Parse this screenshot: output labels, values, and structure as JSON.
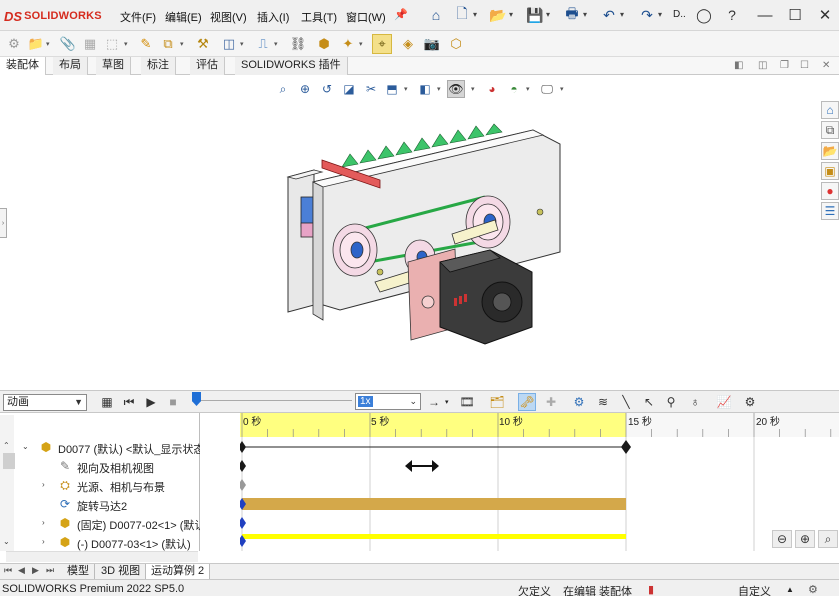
{
  "app": {
    "logo_mark": "DS",
    "logo_text": "SOLIDWORKS"
  },
  "menu": [
    {
      "id": "file",
      "label": "文件(F)"
    },
    {
      "id": "edit",
      "label": "编辑(E)"
    },
    {
      "id": "view",
      "label": "视图(V)"
    },
    {
      "id": "insert",
      "label": "插入(I)"
    },
    {
      "id": "tools",
      "label": "工具(T)"
    },
    {
      "id": "window",
      "label": "窗口(W)"
    }
  ],
  "quick_access": {
    "truncated_label": "D.."
  },
  "command_tabs": [
    {
      "label": "装配体",
      "active": true
    },
    {
      "label": "布局",
      "active": false
    },
    {
      "label": "草图",
      "active": false
    },
    {
      "label": "标注",
      "active": false
    },
    {
      "label": "评估",
      "active": false
    },
    {
      "label": "SOLIDWORKS 插件",
      "active": false
    }
  ],
  "motion": {
    "study_type": "动画",
    "speed": "1x",
    "ruler_labels": [
      "0 秒",
      "5 秒",
      "10 秒",
      "15 秒",
      "20 秒"
    ]
  },
  "tree": [
    {
      "label": "D0077 (默认) <默认_显示状态",
      "expander": "collapse",
      "icon": "assembly-icon"
    },
    {
      "label": "视向及相机视图",
      "expander": "",
      "icon": "camera-icon"
    },
    {
      "label": "光源、相机与布景",
      "expander": "expand",
      "icon": "lights-icon"
    },
    {
      "label": "旋转马达2",
      "expander": "",
      "icon": "rotary-motor-icon"
    },
    {
      "label": "(固定) D0077-02<1> (默认",
      "expander": "expand",
      "icon": "part-icon"
    },
    {
      "label": "(-) D0077-03<1> (默认)",
      "expander": "expand",
      "icon": "part-icon"
    }
  ],
  "bottom_tabs": [
    {
      "label": "模型",
      "active": false
    },
    {
      "label": "3D 视图",
      "active": false
    },
    {
      "label": "运动算例 2",
      "active": true
    }
  ],
  "status": {
    "product": "SOLIDWORKS Premium 2022 SP5.0",
    "definition": "欠定义",
    "editing": "在编辑 装配体",
    "custom": "自定义"
  },
  "colors": {
    "logo": "#d52b1e",
    "ruler_highlight": "#ffff80",
    "motor_bar": "#d4a84a",
    "part_bar": "#ffff00",
    "keyframe": "#1a1a1a",
    "keyframe_blue": "#2040c0"
  }
}
